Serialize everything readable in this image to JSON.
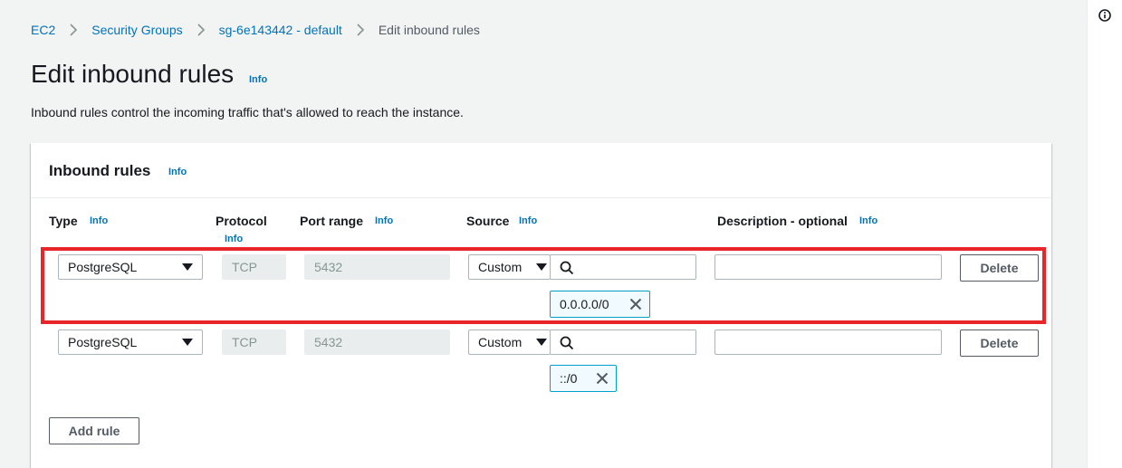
{
  "breadcrumb": {
    "items": [
      "EC2",
      "Security Groups",
      "sg-6e143442 - default"
    ],
    "current": "Edit inbound rules"
  },
  "page": {
    "title": "Edit inbound rules",
    "info": "Info",
    "description": "Inbound rules control the incoming traffic that's allowed to reach the instance."
  },
  "panel": {
    "title": "Inbound rules",
    "info": "Info",
    "columns": {
      "type": "Type",
      "protocol": "Protocol",
      "port_range": "Port range",
      "source": "Source",
      "description": "Description - optional",
      "info": "Info"
    },
    "rules": [
      {
        "type": "PostgreSQL",
        "protocol": "TCP",
        "port_range": "5432",
        "source_type": "Custom",
        "source_query": "",
        "source_token": "0.0.0.0/0",
        "description": "",
        "delete_label": "Delete"
      },
      {
        "type": "PostgreSQL",
        "protocol": "TCP",
        "port_range": "5432",
        "source_type": "Custom",
        "source_query": "",
        "source_token": "::/0",
        "description": "",
        "delete_label": "Delete"
      }
    ],
    "add_rule_label": "Add rule"
  },
  "colors": {
    "link": "#0073bb",
    "highlight": "#e8262a",
    "token_border": "#00a1c9"
  },
  "icons": {
    "rail": "info-circle-icon",
    "search": "search-icon",
    "token_remove": "close-icon",
    "breadcrumb_separator": "chevron-right-icon"
  }
}
